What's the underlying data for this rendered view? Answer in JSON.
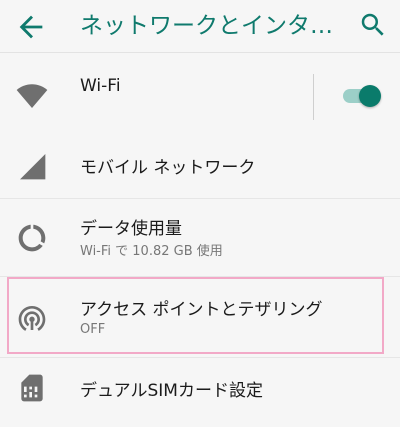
{
  "header": {
    "title": "ネットワークとインターネット",
    "back_icon": "arrow-back-icon",
    "search_icon": "search-icon"
  },
  "items": {
    "wifi": {
      "label": "Wi-Fi",
      "icon": "wifi-icon",
      "toggle_on": true
    },
    "mobile": {
      "label": "モバイル ネットワーク",
      "icon": "signal-icon"
    },
    "data": {
      "label": "データ使用量",
      "sub": "Wi-Fi で 10.82 GB 使用",
      "icon": "data-usage-icon"
    },
    "hotspot": {
      "label": "アクセス ポイントとテザリング",
      "sub": "OFF",
      "icon": "hotspot-icon"
    },
    "sim": {
      "label": "デュアルSIMカード設定",
      "icon": "sim-card-icon"
    }
  },
  "colors": {
    "accent": "#0a7b6b",
    "title": "#0f7a6d",
    "highlight": "#f2a9c7"
  }
}
